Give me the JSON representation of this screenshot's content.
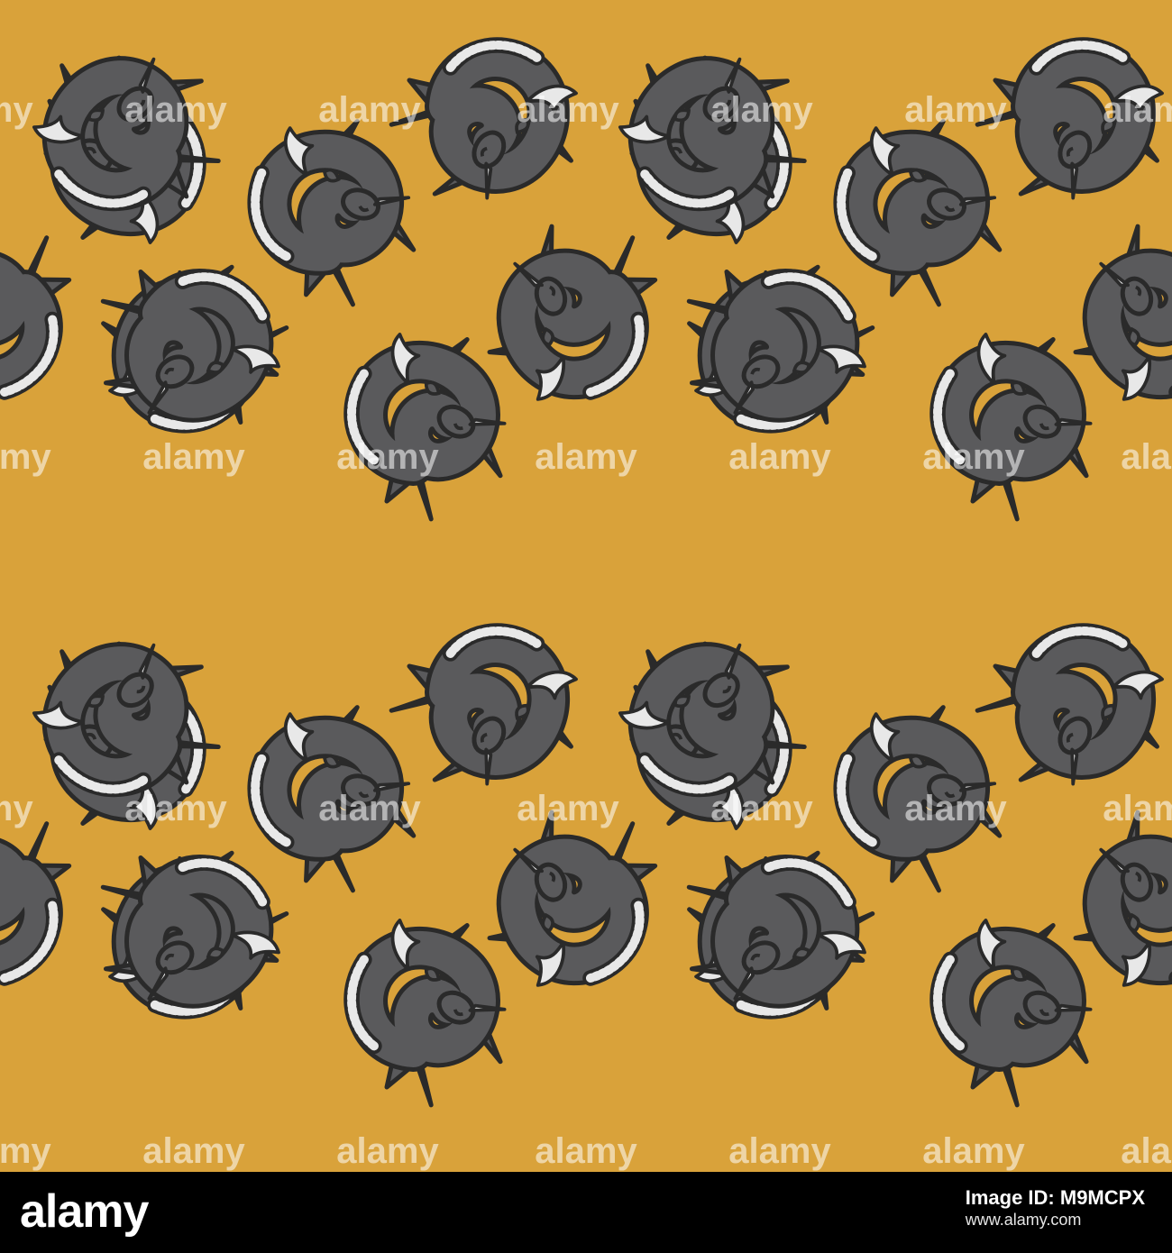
{
  "colors": {
    "background": "#D9A23A",
    "creature_body": "#5A5A5C",
    "outline": "#2A2A2A",
    "mane": "#E8E8E8",
    "watermark": "rgba(255,255,255,0.55)",
    "footer_bg": "#000000"
  },
  "pattern": {
    "motif": "narwhal-unicorn-icon",
    "watermark_text": "alamy"
  },
  "footer": {
    "logo": "alamy",
    "image_id_label": "Image ID: M9MCPX",
    "url": "www.alamy.com"
  }
}
